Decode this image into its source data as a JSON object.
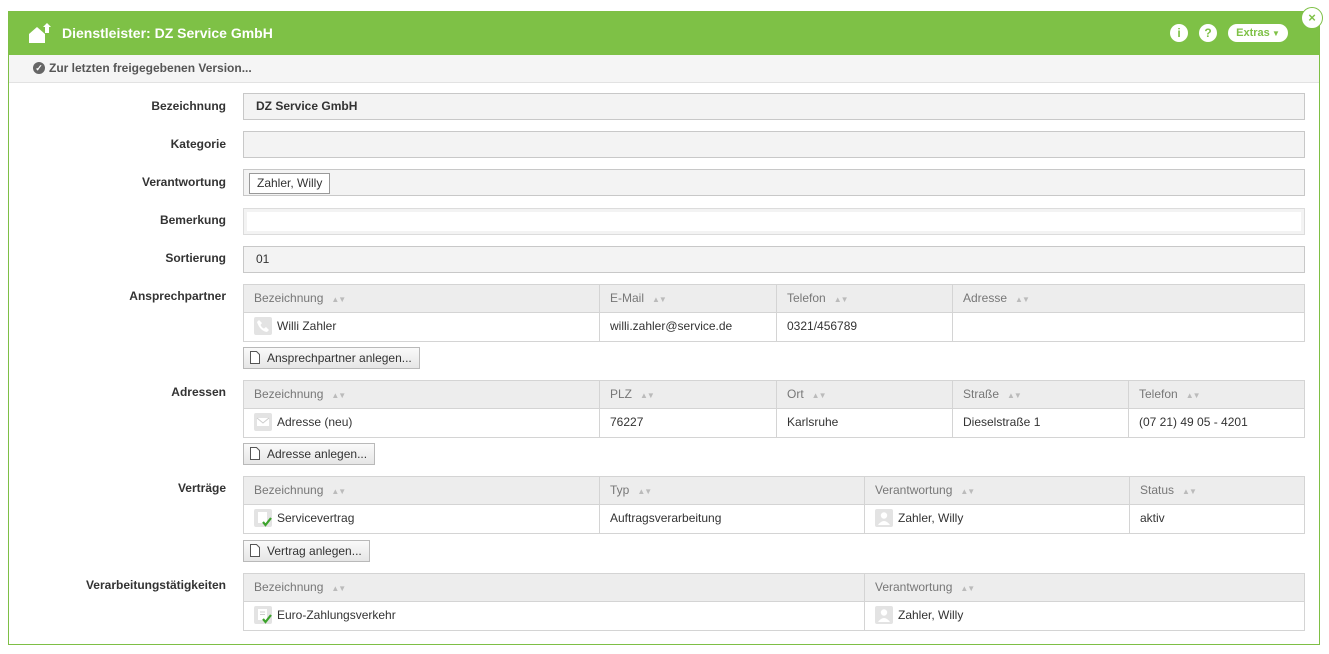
{
  "window": {
    "title": "Dienstleister: DZ Service GmbH",
    "info_label": "i",
    "help_label": "?",
    "extras_label": "Extras",
    "close_label": "×",
    "accent_color": "#7ec146"
  },
  "subbar": {
    "link": "Zur letzten freigegebenen Version..."
  },
  "form": {
    "bezeichnung": {
      "label": "Bezeichnung",
      "value": "DZ Service GmbH"
    },
    "kategorie": {
      "label": "Kategorie",
      "value": ""
    },
    "verantwortung": {
      "label": "Verantwortung",
      "value": "Zahler, Willy"
    },
    "bemerkung": {
      "label": "Bemerkung",
      "value": ""
    },
    "sortierung": {
      "label": "Sortierung",
      "value": "01"
    }
  },
  "ansprechpartner": {
    "label": "Ansprechpartner",
    "columns": [
      "Bezeichnung",
      "E-Mail",
      "Telefon",
      "Adresse"
    ],
    "rows": [
      {
        "name": "Willi Zahler",
        "email": "willi.zahler@service.de",
        "telefon": "0321/456789",
        "adresse": ""
      }
    ],
    "add_button": "Ansprechpartner anlegen..."
  },
  "adressen": {
    "label": "Adressen",
    "columns": [
      "Bezeichnung",
      "PLZ",
      "Ort",
      "Straße",
      "Telefon"
    ],
    "rows": [
      {
        "name": "Adresse (neu)",
        "plz": "76227",
        "ort": "Karlsruhe",
        "strasse": "Dieselstraße 1",
        "telefon": "(07 21) 49 05 - 4201"
      }
    ],
    "add_button": "Adresse anlegen..."
  },
  "vertraege": {
    "label": "Verträge",
    "columns": [
      "Bezeichnung",
      "Typ",
      "Verantwortung",
      "Status"
    ],
    "rows": [
      {
        "name": "Servicevertrag",
        "typ": "Auftragsverarbeitung",
        "verantwortung": "Zahler, Willy",
        "status": "aktiv"
      }
    ],
    "add_button": "Vertrag anlegen..."
  },
  "verarbeitung": {
    "label": "Verarbeitungstätigkeiten",
    "columns": [
      "Bezeichnung",
      "Verantwortung"
    ],
    "rows": [
      {
        "name": "Euro-Zahlungsverkehr",
        "verantwortung": "Zahler, Willy"
      }
    ]
  }
}
